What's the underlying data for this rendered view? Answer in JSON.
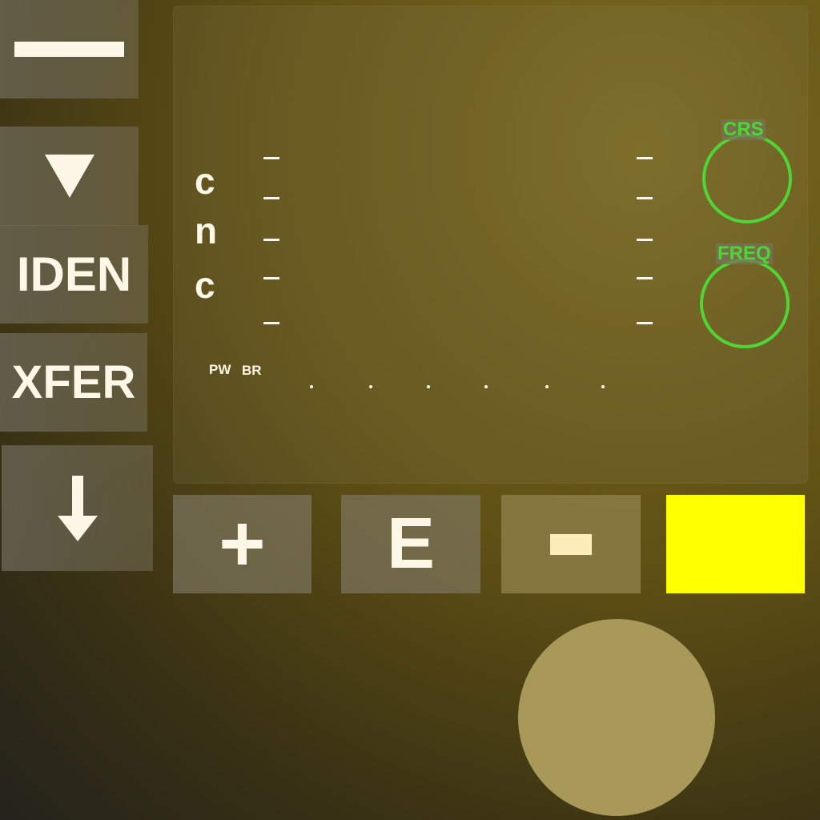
{
  "left_panel": {
    "minus_icon": "minus-bar-icon",
    "down_triangle_icon": "down-triangle-icon",
    "iden_label": "IDEN",
    "xfer_label": "XFER",
    "down_arrow_icon": "down-arrow-icon"
  },
  "display": {
    "mode_letters": [
      "c",
      "n",
      "c"
    ],
    "pw_label": "PW",
    "br_label": "BR",
    "crs_label": "CRS",
    "freq_label": "FREQ"
  },
  "bottom_row": {
    "plus_label": "+",
    "e_label": "E",
    "minus_icon": "minus-icon",
    "yellow_button_color": "#ffff00"
  },
  "colors": {
    "text": "#fcf7e6",
    "knob_ring": "#4fd636",
    "joystick": "#a89958"
  }
}
